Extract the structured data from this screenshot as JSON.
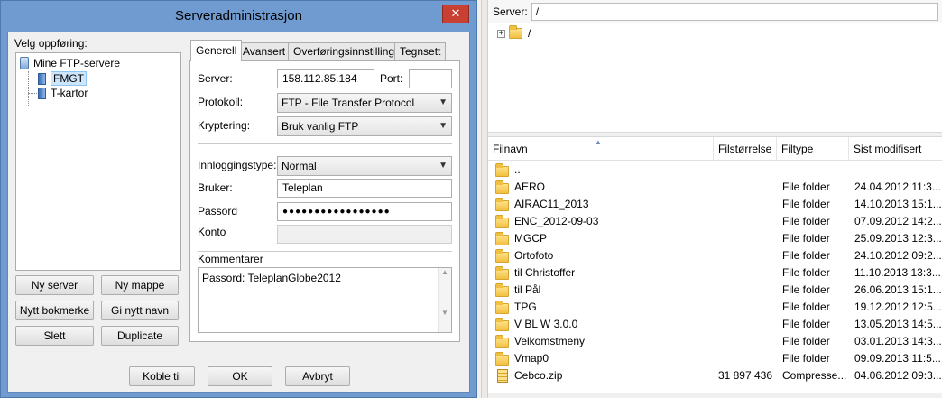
{
  "dialog": {
    "title": "Serveradministrasjon",
    "close_glyph": "✕",
    "entry_label": "Velg oppføring:",
    "tree": {
      "root": "Mine FTP-servere",
      "items": [
        "FMGT",
        "T-kartor"
      ],
      "selected": "FMGT"
    },
    "buttons": {
      "new_server": "Ny server",
      "new_folder": "Ny mappe",
      "new_bookmark": "Nytt bokmerke",
      "rename": "Gi nytt navn",
      "delete": "Slett",
      "duplicate": "Duplicate",
      "connect": "Koble til",
      "ok": "OK",
      "cancel": "Avbryt"
    },
    "tabs": [
      "Generell",
      "Avansert",
      "Overføringsinnstillinger",
      "Tegnsett"
    ],
    "active_tab": "Generell",
    "general": {
      "server_label": "Server:",
      "server_value": "158.112.85.184",
      "port_label": "Port:",
      "port_value": "",
      "protocol_label": "Protokoll:",
      "protocol_value": "FTP - File Transfer Protocol",
      "encryption_label": "Kryptering:",
      "encryption_value": "Bruk vanlig FTP",
      "logon_type_label": "Innloggingstype:",
      "logon_type_value": "Normal",
      "user_label": "Bruker:",
      "user_value": "Teleplan",
      "password_label": "Passord",
      "password_value": "●●●●●●●●●●●●●●●●●",
      "account_label": "Konto",
      "account_value": "",
      "comments_label": "Kommentarer",
      "comments_value": "Passord: TeleplanGlobe2012"
    }
  },
  "remote": {
    "server_label": "Server:",
    "server_path": "/",
    "tree_root": "/",
    "tree_expander": "+",
    "columns": [
      "Filnavn",
      "Filstørrelse",
      "Filtype",
      "Sist modifisert"
    ],
    "files": [
      {
        "name": "..",
        "size": "",
        "type": "",
        "modified": "",
        "icon": "folder-icon"
      },
      {
        "name": "AERO",
        "size": "",
        "type": "File folder",
        "modified": "24.04.2012 11:3...",
        "icon": "folder-icon"
      },
      {
        "name": "AIRAC11_2013",
        "size": "",
        "type": "File folder",
        "modified": "14.10.2013 15:1...",
        "icon": "folder-icon"
      },
      {
        "name": "ENC_2012-09-03",
        "size": "",
        "type": "File folder",
        "modified": "07.09.2012 14:2...",
        "icon": "folder-icon"
      },
      {
        "name": "MGCP",
        "size": "",
        "type": "File folder",
        "modified": "25.09.2013 12:3...",
        "icon": "folder-icon"
      },
      {
        "name": "Ortofoto",
        "size": "",
        "type": "File folder",
        "modified": "24.10.2012 09:2...",
        "icon": "folder-icon"
      },
      {
        "name": "til Christoffer",
        "size": "",
        "type": "File folder",
        "modified": "11.10.2013 13:3...",
        "icon": "folder-icon"
      },
      {
        "name": "til Pål",
        "size": "",
        "type": "File folder",
        "modified": "26.06.2013 15:1...",
        "icon": "folder-icon"
      },
      {
        "name": "TPG",
        "size": "",
        "type": "File folder",
        "modified": "19.12.2012 12:5...",
        "icon": "folder-icon"
      },
      {
        "name": "V BL W 3.0.0",
        "size": "",
        "type": "File folder",
        "modified": "13.05.2013 14:5...",
        "icon": "folder-icon"
      },
      {
        "name": "Velkomstmeny",
        "size": "",
        "type": "File folder",
        "modified": "03.01.2013 14:3...",
        "icon": "folder-icon"
      },
      {
        "name": "Vmap0",
        "size": "",
        "type": "File folder",
        "modified": "09.09.2013 11:5...",
        "icon": "folder-icon"
      },
      {
        "name": "Cebco.zip",
        "size": "31 897 436",
        "type": "Compresse...",
        "modified": "04.06.2012 09:3...",
        "icon": "zip-file-icon"
      }
    ]
  },
  "colors": {
    "dialog_frame": "#6f9bd1",
    "close_button": "#c84031",
    "selection": "#cde6fb"
  }
}
